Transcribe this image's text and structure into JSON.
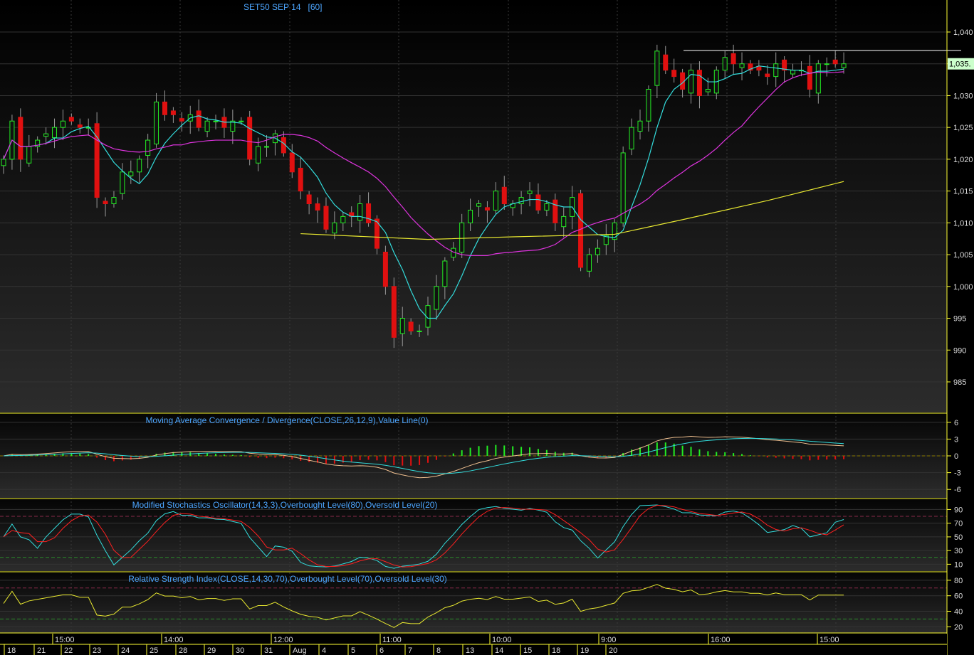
{
  "chart_data": {
    "type": "candlestick",
    "title": "SET50 SEP 14",
    "interval": "[60]",
    "last_price_label": "1,035.",
    "ylim": [
      981,
      1043
    ],
    "y_ticks": [
      1040,
      1035,
      1030,
      1025,
      1020,
      1015,
      1010,
      1005,
      1000,
      995,
      990,
      985
    ],
    "y_tick_labels": [
      "1,040",
      "1,035",
      "1,030",
      "1,025",
      "1,020",
      "1,015",
      "1,010",
      "1,005",
      "1,000",
      "995",
      "990",
      "985"
    ],
    "resistance_line": 1037.1,
    "closes": [
      1020,
      1026,
      1020,
      1022,
      1023,
      1024,
      1025,
      1026,
      1026,
      1025,
      1025,
      1014,
      1013,
      1014,
      1018,
      1018,
      1020,
      1023,
      1029,
      1027,
      1027,
      1026,
      1027,
      1025,
      1026,
      1026,
      1025,
      1026,
      1026,
      1020,
      1022,
      1022,
      1024,
      1021,
      1018,
      1015,
      1013,
      1012,
      1009,
      1010,
      1011,
      1011,
      1013,
      1010,
      1006,
      1000,
      992,
      995,
      993,
      993,
      997,
      1000,
      1004,
      1006,
      1010,
      1012,
      1013,
      1012,
      1015,
      1013,
      1013,
      1014,
      1015,
      1012,
      1013,
      1010,
      1011,
      1014,
      1003,
      1005,
      1006,
      1008,
      1010,
      1021,
      1025,
      1026,
      1031,
      1037,
      1034,
      1033,
      1031,
      1034,
      1030,
      1031,
      1034,
      1036,
      1035,
      1035,
      1034,
      1034,
      1033,
      1035,
      1034,
      1034,
      1034,
      1031,
      1035,
      1035,
      1035,
      1035
    ],
    "moving_averages": [
      {
        "name": "short MA",
        "color": "#33dddd",
        "period": 6
      },
      {
        "name": "medium MA",
        "color": "#dd33dd",
        "period": 20
      },
      {
        "name": "long MA",
        "color": "#e8e830",
        "points": [
          [
            35,
            1008.3
          ],
          [
            50,
            1007.4
          ],
          [
            60,
            1007.8
          ],
          [
            72,
            1008.2
          ],
          [
            80,
            1010.5
          ],
          [
            90,
            1013.5
          ],
          [
            99,
            1016.5
          ]
        ]
      }
    ],
    "time_labels": [
      "15:00",
      "14:00",
      "12:00",
      "11:00",
      "10:00",
      "9:00",
      "16:00",
      "15:00"
    ],
    "date_labels": [
      "18",
      "21",
      "22",
      "23",
      "24",
      "25",
      "28",
      "29",
      "30",
      "31",
      "Aug",
      "4",
      "5",
      "6",
      "7",
      "8",
      "13",
      "14",
      "15",
      "18",
      "19",
      "20"
    ],
    "macd": {
      "title": "Moving Average Convergence / Divergence(CLOSE,26,12,9),Value Line(0)",
      "ylim": [
        -7.5,
        7.5
      ],
      "ticks": [
        "6",
        "3",
        "0",
        "-3",
        "-6"
      ],
      "tick_values": [
        6,
        3,
        0,
        -3,
        -6
      ]
    },
    "stochastic": {
      "title": "Modified Stochastics Oscillator(14,3,3),Overbought Level(80),Oversold Level(20)",
      "ylim": [
        0,
        105
      ],
      "ticks": [
        "90",
        "70",
        "50",
        "30",
        "10"
      ],
      "tick_values": [
        90,
        70,
        50,
        30,
        10
      ],
      "overbought": 80,
      "oversold": 20
    },
    "rsi": {
      "title": "Relative Strength Index(CLOSE,14,30,70),Overbought Level(70),Oversold Level(30)",
      "ylim": [
        12,
        90
      ],
      "ticks": [
        "80",
        "60",
        "40",
        "20"
      ],
      "tick_values": [
        80,
        60,
        40,
        20
      ],
      "overbought": 70,
      "oversold": 30
    }
  },
  "colors": {
    "up": "#22ee22",
    "down": "#e01010",
    "title": "#4da6ff",
    "axis": "#ffff33",
    "label_bg": "#ccffcc"
  }
}
